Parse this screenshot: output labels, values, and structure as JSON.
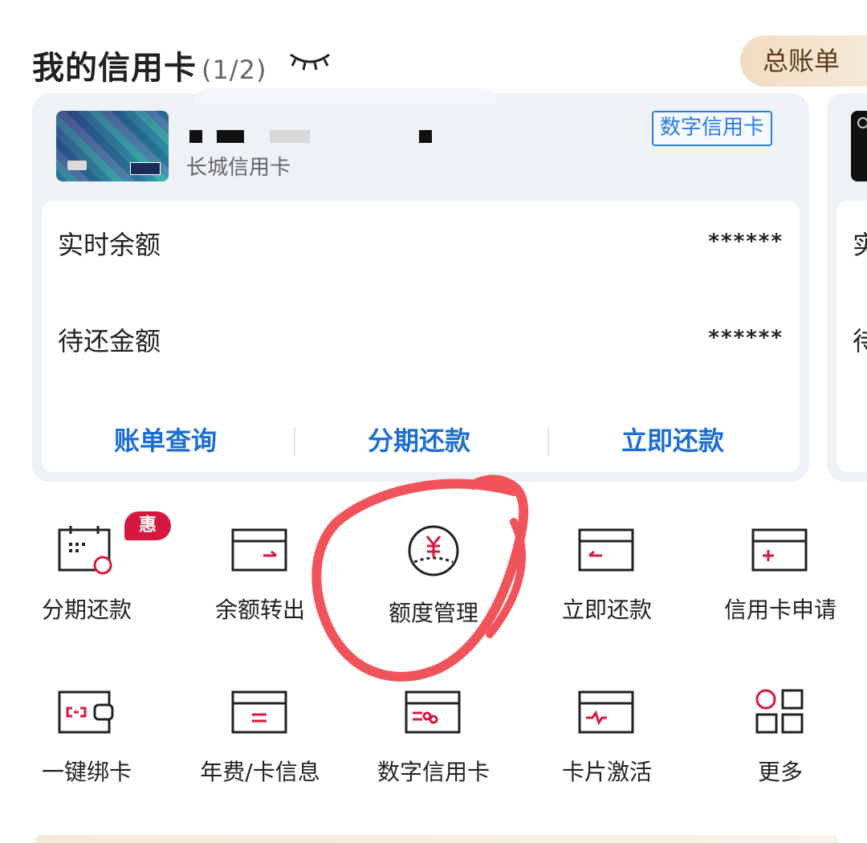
{
  "header": {
    "title": "我的信用卡",
    "count": "(1/2)",
    "bill_button": "总账单"
  },
  "card": {
    "name": "长城信用卡",
    "badge": "数字信用卡",
    "balance_label": "实时余额",
    "balance_value": "******",
    "due_label": "待还金额",
    "due_value": "******",
    "actions": [
      "账单查询",
      "分期还款",
      "立即还款"
    ]
  },
  "peek_card": {
    "label_1": "实",
    "label_2": "待"
  },
  "services": {
    "promo_badge": "惠",
    "items": [
      {
        "label": "分期还款",
        "icon": "calendar-installment-icon"
      },
      {
        "label": "余额转出",
        "icon": "card-transfer-out-icon"
      },
      {
        "label": "额度管理",
        "icon": "yuan-limit-icon"
      },
      {
        "label": "立即还款",
        "icon": "card-repay-icon"
      },
      {
        "label": "信用卡申请",
        "icon": "card-apply-icon"
      },
      {
        "label": "一键绑卡",
        "icon": "wallet-link-icon"
      },
      {
        "label": "年费/卡信息",
        "icon": "card-info-icon"
      },
      {
        "label": "数字信用卡",
        "icon": "digital-card-icon"
      },
      {
        "label": "卡片激活",
        "icon": "card-activate-icon"
      },
      {
        "label": "更多",
        "icon": "more-grid-icon"
      }
    ]
  },
  "colors": {
    "accent_blue": "#1c6ed4",
    "icon_red": "#d6183e",
    "annotation_red": "#f0545a"
  }
}
